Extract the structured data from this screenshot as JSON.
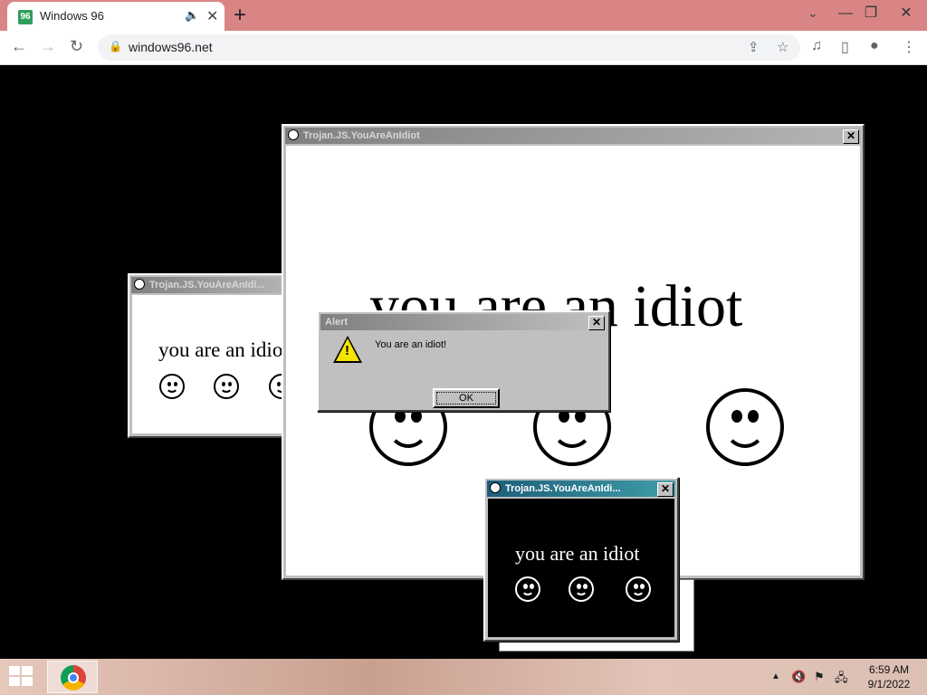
{
  "browser": {
    "tab_title": "Windows 96",
    "tab_audio_icon": "speaker-icon",
    "new_tab": "+",
    "url": "windows96.net",
    "controls": {
      "minimize": "—",
      "maximize": "❐",
      "close": "✕",
      "tab_search": "⌄"
    }
  },
  "windows": {
    "large": {
      "title": "Trojan.JS.YouAreAnIdiot",
      "text": "you are an idiot"
    },
    "left": {
      "title": "Trojan.JS.YouAreAnIdi...",
      "text": "you are an idiot"
    },
    "small": {
      "title": "Trojan.JS.YouAreAnIdi...",
      "text": "you are an idiot"
    }
  },
  "alert": {
    "title": "Alert",
    "message": "You are an idiot!",
    "ok": "OK"
  },
  "taskbar": {
    "time": "6:59 AM",
    "date": "9/1/2022"
  },
  "colors": {
    "active_title": "#1c5e7a",
    "inactive_title": "#808080",
    "warning": "#f5e400"
  }
}
